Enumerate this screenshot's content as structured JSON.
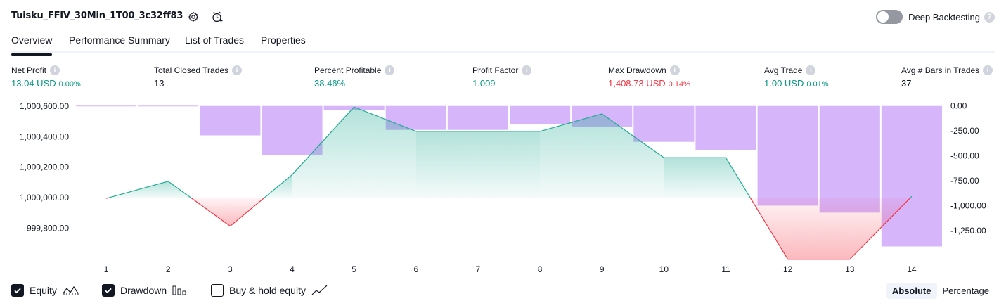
{
  "header": {
    "title": "Tuisku_FFIV_30Min_1T00_3c32ff83",
    "settings_icon": "gear-icon",
    "alert_icon": "alarm-clock-plus-icon",
    "deep_backtesting_label": "Deep Backtesting",
    "deep_backtesting_enabled": false
  },
  "tabs": [
    {
      "label": "Overview",
      "active": true
    },
    {
      "label": "Performance Summary",
      "active": false
    },
    {
      "label": "List of Trades",
      "active": false
    },
    {
      "label": "Properties",
      "active": false
    }
  ],
  "stats": [
    {
      "label": "Net Profit",
      "value": "13.04 USD",
      "pct": "0.00%",
      "color": "green"
    },
    {
      "label": "Total Closed Trades",
      "value": "13",
      "pct": "",
      "color": "dark"
    },
    {
      "label": "Percent Profitable",
      "value": "38.46%",
      "pct": "",
      "color": "green"
    },
    {
      "label": "Profit Factor",
      "value": "1.009",
      "pct": "",
      "color": "green"
    },
    {
      "label": "Max Drawdown",
      "value": "1,408.73 USD",
      "pct": "0.14%",
      "color": "red"
    },
    {
      "label": "Avg Trade",
      "value": "1.00 USD",
      "pct": "0.01%",
      "color": "green"
    },
    {
      "label": "Avg # Bars in Trades",
      "value": "37",
      "pct": "",
      "color": "dark"
    }
  ],
  "chart_data": {
    "type": "line",
    "x": [
      1,
      2,
      3,
      4,
      5,
      6,
      7,
      8,
      9,
      10,
      11,
      12,
      13,
      14
    ],
    "left_axis": {
      "ticks": [
        "1,000,600.00",
        "1,000,400.00",
        "1,000,200.00",
        "1,000,000.00",
        "999,800.00"
      ],
      "tick_values": [
        1000600,
        1000400,
        1000200,
        1000000,
        999800
      ],
      "range": [
        999640,
        1000605
      ]
    },
    "right_axis": {
      "ticks": [
        "0.00",
        "-250.00",
        "-500.00",
        "-750.00",
        "-1,000.00",
        "-1,250.00"
      ],
      "tick_values": [
        0,
        -250,
        -500,
        -750,
        -1000,
        -1250
      ],
      "range": [
        -1470,
        5
      ]
    },
    "equity": [
      999995,
      1000107,
      999813,
      1000150,
      1000595,
      1000435,
      1000435,
      1000435,
      1000550,
      1000262,
      1000262,
      999595,
      999595,
      1000008
    ],
    "drawdown_bars": [
      {
        "x": 1,
        "value": 0
      },
      {
        "x": 2,
        "value": 0
      },
      {
        "x": 3,
        "value": -295
      },
      {
        "x": 4,
        "value": -490
      },
      {
        "x": 5,
        "value": -40
      },
      {
        "x": 6,
        "value": -240
      },
      {
        "x": 7,
        "value": -240
      },
      {
        "x": 8,
        "value": -180
      },
      {
        "x": 9,
        "value": -210
      },
      {
        "x": 10,
        "value": -360
      },
      {
        "x": 11,
        "value": -440
      },
      {
        "x": 12,
        "value": -1000
      },
      {
        "x": 13,
        "value": -1070
      },
      {
        "x": 14,
        "value": -1410
      }
    ],
    "colors": {
      "equity_up": "#22ab94",
      "equity_down": "#f23645",
      "drawdown": "#d6b5fb"
    }
  },
  "legend": {
    "items": [
      {
        "label": "Equity",
        "checked": true,
        "icon": "equity-line-icon"
      },
      {
        "label": "Drawdown",
        "checked": true,
        "icon": "bar-chart-icon"
      },
      {
        "label": "Buy & hold equity",
        "checked": false,
        "icon": "trend-line-icon"
      }
    ],
    "modes": [
      {
        "label": "Absolute",
        "active": true
      },
      {
        "label": "Percentage",
        "active": false
      }
    ]
  }
}
